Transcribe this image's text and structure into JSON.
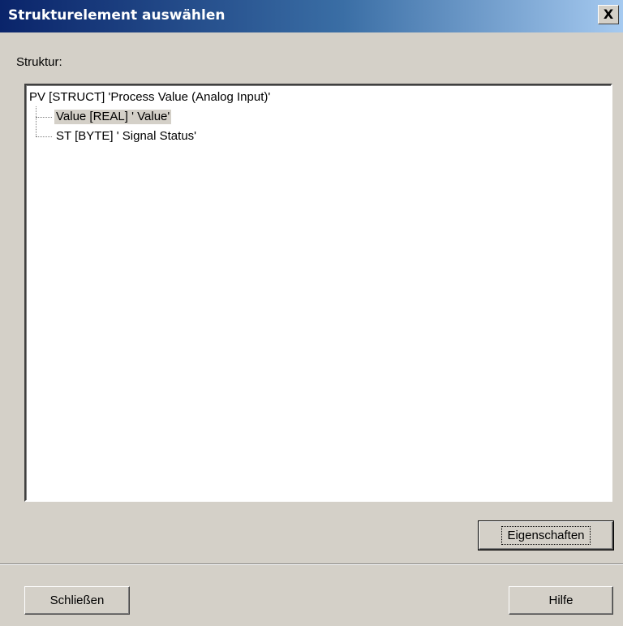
{
  "window": {
    "title": "Strukturelement auswählen",
    "close_glyph": "X"
  },
  "structure": {
    "label": "Struktur:",
    "tree": {
      "root": "PV [STRUCT] 'Process Value (Analog Input)'",
      "children": [
        {
          "label": "Value [REAL] ' Value'",
          "selected": true
        },
        {
          "label": "ST [BYTE] ' Signal Status'",
          "selected": false
        }
      ]
    }
  },
  "buttons": {
    "properties": "Eigenschaften",
    "close": "Schließen",
    "help": "Hilfe"
  },
  "colors": {
    "titlebar_start": "#0a246a",
    "titlebar_end": "#a6caf0",
    "dialog_bg": "#d4d0c8"
  }
}
